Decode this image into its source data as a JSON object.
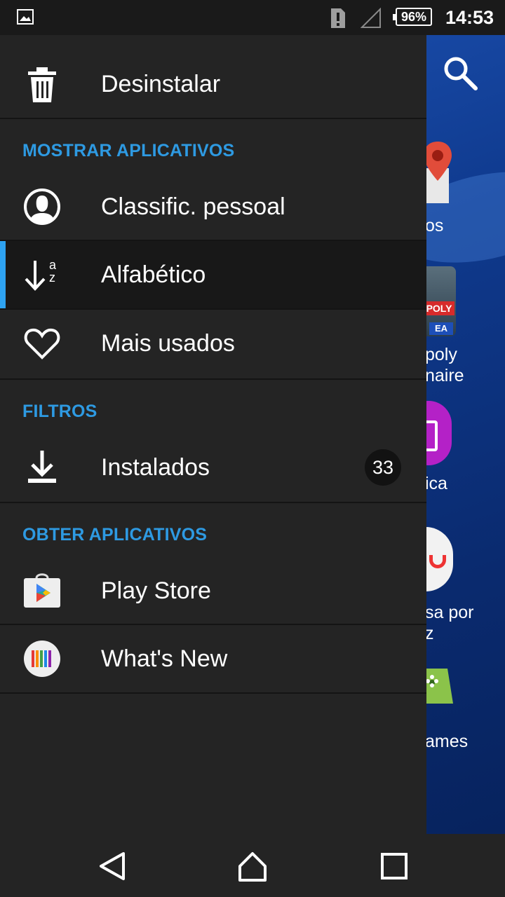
{
  "status_bar": {
    "battery": "96%",
    "time": "14:53",
    "icons": [
      "gallery-notification-icon",
      "sim-alert-icon",
      "signal-icon",
      "battery-icon"
    ]
  },
  "background": {
    "labels": [
      "os",
      "poly",
      "naire",
      "ica",
      "sa por",
      "z",
      "ames"
    ]
  },
  "drawer": {
    "uninstall": {
      "label": "Desinstalar",
      "icon": "trash-icon"
    },
    "section_show": "MOSTRAR APLICATIVOS",
    "sort_items": [
      {
        "label": "Classific. pessoal",
        "icon": "person-icon"
      },
      {
        "label": "Alfabético",
        "icon": "sort-az-icon",
        "selected": true
      },
      {
        "label": "Mais usados",
        "icon": "heart-icon"
      }
    ],
    "section_filters": "FILTROS",
    "installed": {
      "label": "Instalados",
      "count": "33",
      "icon": "download-icon"
    },
    "section_get": "OBTER APLICATIVOS",
    "get_items": [
      {
        "label": "Play Store",
        "icon": "play-store-icon"
      },
      {
        "label": "What's New",
        "icon": "whats-new-icon"
      }
    ]
  },
  "nav_bar": {
    "buttons": [
      "back-icon",
      "home-icon",
      "recents-icon"
    ]
  },
  "colors": {
    "accent": "#2e9ae2",
    "drawer_bg": "#242424",
    "selected_bar": "#2ea3f2"
  }
}
